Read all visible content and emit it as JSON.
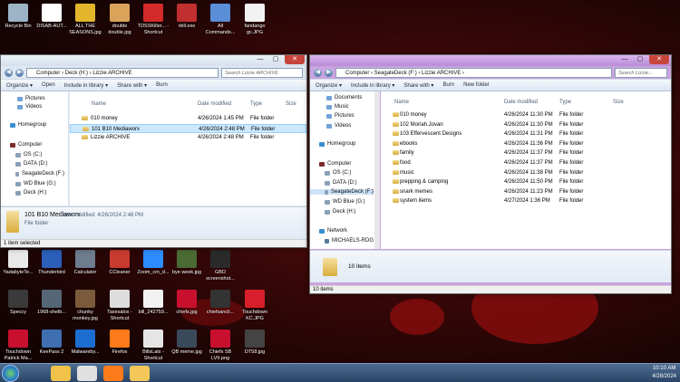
{
  "desktop_icons": [
    {
      "label": "Recycle Bin",
      "icon": "recycle-bin-icon",
      "color": "#9db4c7"
    },
    {
      "label": "DISAB-AUT...",
      "icon": "document-icon",
      "color": "#ffffff"
    },
    {
      "label": "ALL THE SEASONS.jpg",
      "icon": "image-icon",
      "color": "#e3b52b"
    },
    {
      "label": "double double.jpg",
      "icon": "image-icon",
      "color": "#d9a35a"
    },
    {
      "label": "TDSSKiller... - Shortcut",
      "icon": "kaspersky-icon",
      "color": "#d42a2a"
    },
    {
      "label": "rkill.exe",
      "icon": "rkill-icon",
      "color": "#c12f2f"
    },
    {
      "label": "All Commands...",
      "icon": "control-panel-icon",
      "color": "#5a8ed6"
    },
    {
      "label": "fandango gc.JPG",
      "icon": "image-icon",
      "color": "#f2f2f2"
    },
    {
      "label": "YadabyteTe...",
      "icon": "yadabyte-icon",
      "color": "#e9e9e9"
    },
    {
      "label": "Thunderbird",
      "icon": "thunderbird-icon",
      "color": "#2b5fb8"
    },
    {
      "label": "Calculator",
      "icon": "calculator-icon",
      "color": "#6d7c8e"
    },
    {
      "label": "CCleaner",
      "icon": "ccleaner-icon",
      "color": "#c93a2f"
    },
    {
      "label": "Zoom_cm_d...",
      "icon": "zoom-icon",
      "color": "#2d8cff"
    },
    {
      "label": "bye week.jpg",
      "icon": "image-icon",
      "color": "#4a6b34"
    },
    {
      "label": "GBD screenshot...",
      "icon": "image-icon",
      "color": "#2a2a2a"
    },
    {
      "label": "Speccy",
      "icon": "speccy-icon",
      "color": "#3a3a3a"
    },
    {
      "label": "1968-shelb...",
      "icon": "image-icon",
      "color": "#556677"
    },
    {
      "label": "chunky monkey.jpg",
      "icon": "image-icon",
      "color": "#7a5a3a"
    },
    {
      "label": "Taxesalox - Shortcut",
      "icon": "shortcut-icon",
      "color": "#dddddd"
    },
    {
      "label": "bill_242759...",
      "icon": "image-icon",
      "color": "#f2f2f2"
    },
    {
      "label": "chiefs.jpg",
      "icon": "chiefs-icon",
      "color": "#c8102e"
    },
    {
      "label": "chiefsancli...",
      "icon": "image-icon",
      "color": "#333333"
    },
    {
      "label": "Touchdown KC.JPG",
      "icon": "image-icon",
      "color": "#d81e2a"
    },
    {
      "label": "Touchdown Patrick Ma...",
      "icon": "image-icon",
      "color": "#c8102e"
    },
    {
      "label": "KeePass 2",
      "icon": "keepass-icon",
      "color": "#3f6fb0"
    },
    {
      "label": "Malwareby...",
      "icon": "malwarebytes-icon",
      "color": "#1c6dd0"
    },
    {
      "label": "Firefox",
      "icon": "firefox-icon",
      "color": "#ff7a1a"
    },
    {
      "label": "BillsLatx - Shortcut",
      "icon": "shortcut-icon",
      "color": "#e5e5e5"
    },
    {
      "label": "QB meme.jpg",
      "icon": "image-icon",
      "color": "#3a4a5a"
    },
    {
      "label": "Chiefs SB LVII.png",
      "icon": "image-icon",
      "color": "#c8102e"
    },
    {
      "label": "DT58.jpg",
      "icon": "image-icon",
      "color": "#444444"
    },
    {
      "label": "manomes-d...",
      "icon": "image-icon",
      "color": "#884433"
    }
  ],
  "window1": {
    "address": "Computer › Deck (H:) › Lizzie ARCHIVE",
    "search_placeholder": "Search Lizzie ARCHIVE",
    "toolbar": [
      "Organize ▾",
      "Open",
      "Include in library ▾",
      "Share with ▾",
      "Burn"
    ],
    "nav": [
      {
        "label": "Pictures",
        "icon": "pictures-icon",
        "color": "#6fa3d8"
      },
      {
        "label": "Videos",
        "icon": "videos-icon",
        "color": "#6fa3d8"
      },
      {
        "label": "Homegroup",
        "icon": "homegroup-icon",
        "color": "#3a8ed0"
      },
      {
        "label": "Computer",
        "icon": "computer-icon",
        "color": "#7a2a2a"
      },
      {
        "label": "OS (C:)",
        "icon": "drive-icon",
        "color": "#8aa0b8"
      },
      {
        "label": "DATA (D:)",
        "icon": "drive-icon",
        "color": "#8aa0b8"
      },
      {
        "label": "SeagateDeck (F:)",
        "icon": "drive-icon",
        "color": "#8aa0b8"
      },
      {
        "label": "WD Blue (G:)",
        "icon": "drive-icon",
        "color": "#8aa0b8"
      },
      {
        "label": "Deck (H:)",
        "icon": "drive-icon",
        "color": "#8aa0b8"
      }
    ],
    "columns": [
      "Name",
      "Date modified",
      "Type",
      "Size"
    ],
    "files": [
      {
        "name": "010 money",
        "date": "4/26/2024 1:45 PM",
        "type": "File folder"
      },
      {
        "name": "101 B10 Mediaworx",
        "date": "4/26/2024 2:48 PM",
        "type": "File folder"
      },
      {
        "name": "Lizzie ARCHIVE",
        "date": "4/26/2024 2:48 PM",
        "type": "File folder"
      }
    ],
    "details": {
      "name": "101 B10 Mediaworx",
      "date_label": "Date modified: 4/26/2024 2:48 PM",
      "type": "File folder"
    },
    "status": "1 item selected"
  },
  "window2": {
    "address": "Computer › SeagateDeck (F:) › Lizzie ARCHIVE ›",
    "search_placeholder": "Search Lizzie...",
    "toolbar": [
      "Organize ▾",
      "Include in library ▾",
      "Share with ▾",
      "Burn",
      "New folder"
    ],
    "nav": [
      {
        "label": "Documents",
        "icon": "documents-icon",
        "color": "#6fa3d8"
      },
      {
        "label": "Music",
        "icon": "music-icon",
        "color": "#6fa3d8"
      },
      {
        "label": "Pictures",
        "icon": "pictures-icon",
        "color": "#6fa3d8"
      },
      {
        "label": "Videos",
        "icon": "videos-icon",
        "color": "#6fa3d8"
      },
      {
        "label": "Homegroup",
        "icon": "homegroup-icon",
        "color": "#3a8ed0"
      },
      {
        "label": "Computer",
        "icon": "computer-icon",
        "color": "#7a2a2a"
      },
      {
        "label": "OS (C:)",
        "icon": "drive-icon",
        "color": "#8aa0b8"
      },
      {
        "label": "DATA (D:)",
        "icon": "drive-icon",
        "color": "#8aa0b8"
      },
      {
        "label": "SeagateDeck (F:)",
        "icon": "drive-icon",
        "color": "#8aa0b8"
      },
      {
        "label": "WD Blue (G:)",
        "icon": "drive-icon",
        "color": "#8aa0b8"
      },
      {
        "label": "Deck (H:)",
        "icon": "drive-icon",
        "color": "#8aa0b8"
      },
      {
        "label": "Network",
        "icon": "network-icon",
        "color": "#3a8ed0"
      },
      {
        "label": "MICHAELS-RDG",
        "icon": "computer-icon",
        "color": "#5a7a9a"
      }
    ],
    "columns": [
      "Name",
      "Date modified",
      "Type",
      "Size"
    ],
    "files": [
      {
        "name": "010 money",
        "date": "4/26/2024 11:30 PM",
        "type": "File folder"
      },
      {
        "name": "102 Moriah.Jovan",
        "date": "4/26/2024 11:30 PM",
        "type": "File folder"
      },
      {
        "name": "103 Effervescent Designs",
        "date": "4/26/2024 11:31 PM",
        "type": "File folder"
      },
      {
        "name": "ebooks",
        "date": "4/26/2024 11:36 PM",
        "type": "File folder"
      },
      {
        "name": "family",
        "date": "4/26/2024 11:37 PM",
        "type": "File folder"
      },
      {
        "name": "food",
        "date": "4/26/2024 11:37 PM",
        "type": "File folder"
      },
      {
        "name": "music",
        "date": "4/26/2024 11:38 PM",
        "type": "File folder"
      },
      {
        "name": "prepping & camping",
        "date": "4/26/2024 11:50 PM",
        "type": "File folder"
      },
      {
        "name": "snark memes",
        "date": "4/26/2024 11:23 PM",
        "type": "File folder"
      },
      {
        "name": "system items",
        "date": "4/27/2024 1:36 PM",
        "type": "File folder"
      }
    ],
    "details": {
      "count": "10 items"
    },
    "status": "10 items"
  },
  "taskbar": {
    "time": "10:10 AM",
    "date": "4/28/2024",
    "pinned": [
      {
        "icon": "explorer-icon",
        "color": "#f0c24a"
      },
      {
        "icon": "chrome-icon",
        "color": "#e0e0e0"
      },
      {
        "icon": "firefox-icon",
        "color": "#ff7a1a"
      },
      {
        "icon": "folder-icon",
        "color": "#f3c75a"
      }
    ]
  }
}
